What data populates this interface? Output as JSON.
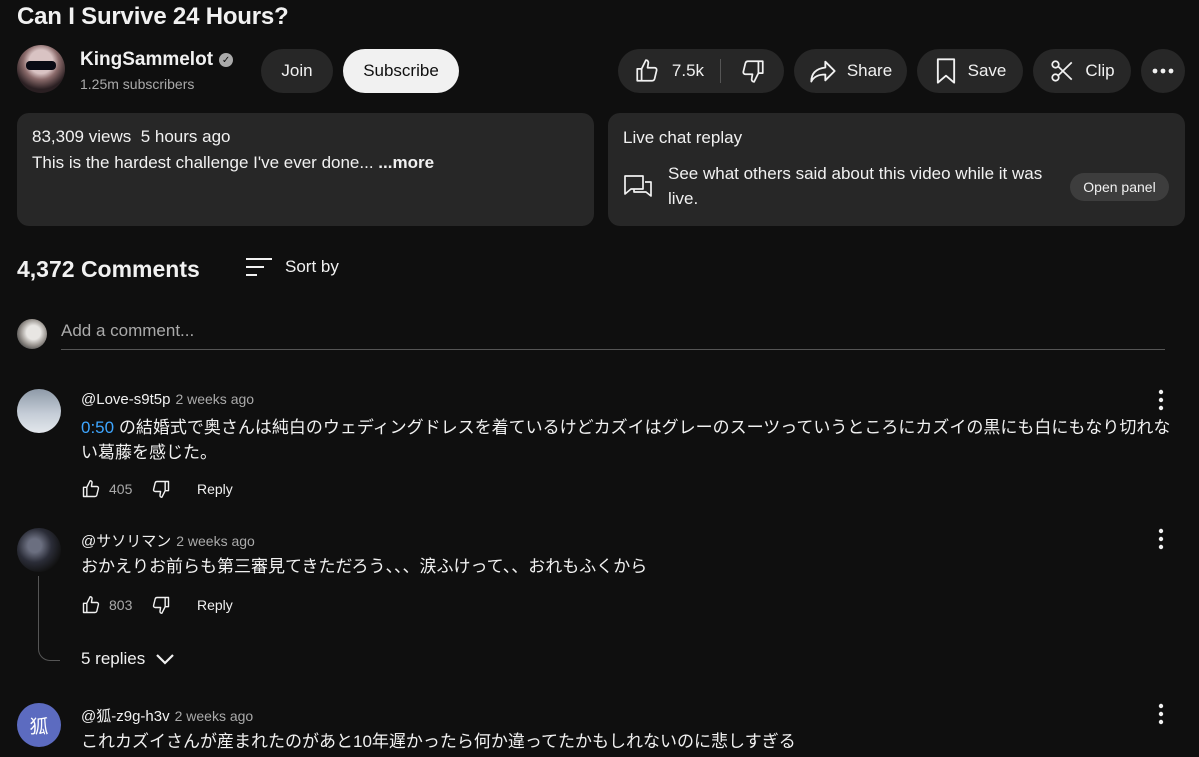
{
  "video": {
    "title": "Can I Survive 24 Hours?"
  },
  "channel": {
    "name": "KingSammelot",
    "verified_icon": "verified-check-icon",
    "subscribers": "1.25m subscribers",
    "join_label": "Join",
    "subscribe_label": "Subscribe"
  },
  "actions": {
    "likes": "7.5k",
    "share_label": "Share",
    "save_label": "Save",
    "clip_label": "Clip"
  },
  "description": {
    "views": "83,309 views",
    "age": "5 hours ago",
    "text": "This is the hardest challenge I've ever done... ",
    "more_label": "...more"
  },
  "live_chat": {
    "title": "Live chat replay",
    "text": "See what others said about this video while it was live.",
    "open_label": "Open panel"
  },
  "comments": {
    "count_label": "4,372 Comments",
    "sort_label": "Sort by",
    "add_placeholder": "Add a comment...",
    "reply_label": "Reply",
    "items": [
      {
        "handle": "@Love-s9t5p",
        "time": "2 weeks ago",
        "timestamp": "0:50",
        "text": " の結婚式で奥さんは純白のウェディングドレスを着ているけどカズイはグレーのスーツっていうところにカズイの黒にも白にもなり切れない葛藤を感じた。",
        "likes": "405"
      },
      {
        "handle": "@サソリマン",
        "time": "2 weeks ago",
        "text": "おかえりお前らも第三審見てきただろう、、、涙ふけって、、おれもふくから",
        "likes": "803",
        "replies_label": "5 replies"
      },
      {
        "handle": "@狐-z9g-h3v",
        "time": "2 weeks ago",
        "avatar_letter": "狐",
        "text": "これカズイさんが産まれたのがあと10年遅かったら何か違ってたかもしれないのに悲しすぎる"
      }
    ]
  },
  "colors": {
    "background": "#0f0f0f",
    "surface": "#272727",
    "link": "#3ea6ff",
    "avatar_purple": "#5c6bc0"
  }
}
